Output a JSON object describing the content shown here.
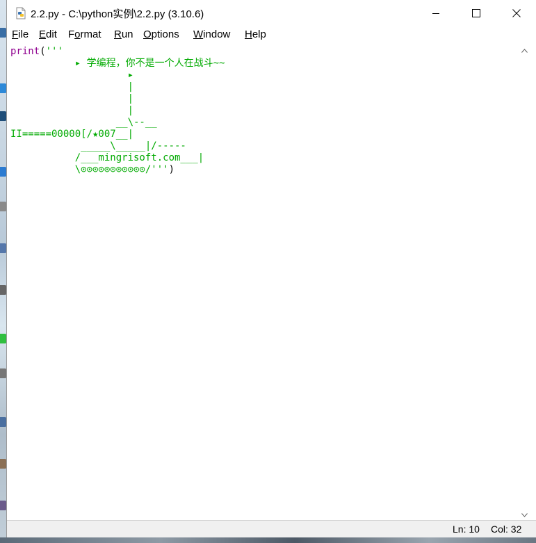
{
  "window": {
    "title": "2.2.py - C:\\python实例\\2.2.py (3.10.6)",
    "controls": {
      "minimize_icon": "minimize-icon",
      "maximize_icon": "maximize-icon",
      "close_icon": "close-icon"
    }
  },
  "menubar": {
    "items": [
      {
        "label": "File",
        "mnemonic": "F",
        "rest": "ile"
      },
      {
        "label": "Edit",
        "mnemonic": "E",
        "rest": "dit"
      },
      {
        "label": "Format",
        "mnemonic": "o",
        "pre": "F",
        "rest": "rmat"
      },
      {
        "label": "Run",
        "mnemonic": "R",
        "rest": "un"
      },
      {
        "label": "Options",
        "mnemonic": "O",
        "rest": "ptions"
      },
      {
        "label": "Window",
        "mnemonic": "W",
        "rest": "indow"
      },
      {
        "label": "Help",
        "mnemonic": "H",
        "rest": "elp"
      }
    ]
  },
  "editor": {
    "keyword": "print",
    "open_paren": "(",
    "string_body": "'''\n           ▸ 学编程，你不是一个人在战斗~~\n                    ▸\n                    |\n                    |\n                    |\n                  __\\--__\nII=====00000[/★007__|\n            _____\\_____|/-----\n           /___mingrisoft.com___|\n           \\⊙⊙⊙⊙⊙⊙⊙⊙⊙⊙⊙/'''",
    "close_paren": ")"
  },
  "status": {
    "line": "Ln: 10",
    "col": "Col: 32"
  },
  "colors": {
    "keyword": "#900090",
    "string": "#00aa00",
    "background": "#ffffff"
  }
}
